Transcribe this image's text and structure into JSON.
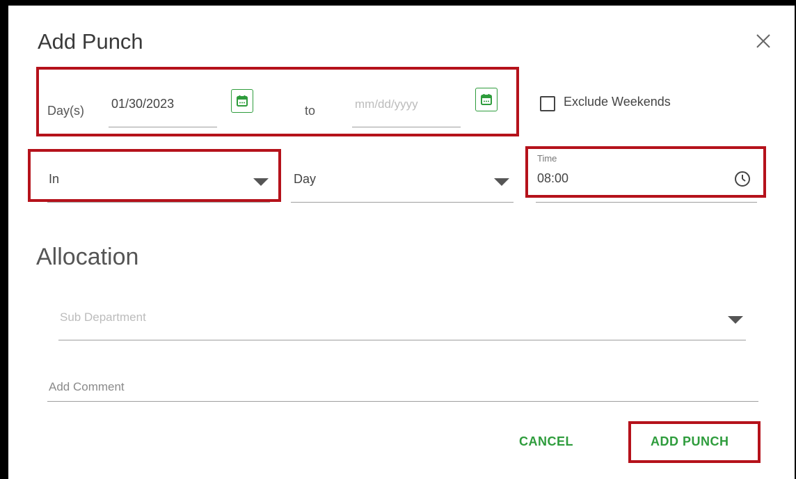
{
  "dialog": {
    "title": "Add Punch",
    "close_icon": "close-icon"
  },
  "days": {
    "label": "Day(s)",
    "start_value": "01/30/2023",
    "to_label": "to",
    "end_placeholder": "mm/dd/yyyy",
    "calendar_icon": "calendar-icon"
  },
  "exclude_weekends": {
    "label": "Exclude Weekends",
    "checked": false
  },
  "punch_type": {
    "value": "In"
  },
  "day_select": {
    "value": "Day"
  },
  "time": {
    "label": "Time",
    "value": "08:00",
    "icon": "clock-icon"
  },
  "allocation": {
    "heading": "Allocation",
    "sub_department_placeholder": "Sub Department"
  },
  "comment": {
    "placeholder": "Add Comment"
  },
  "actions": {
    "cancel": "CANCEL",
    "add_punch": "ADD PUNCH"
  },
  "colors": {
    "accent": "#2e9c3c",
    "highlight": "#b5121b"
  }
}
